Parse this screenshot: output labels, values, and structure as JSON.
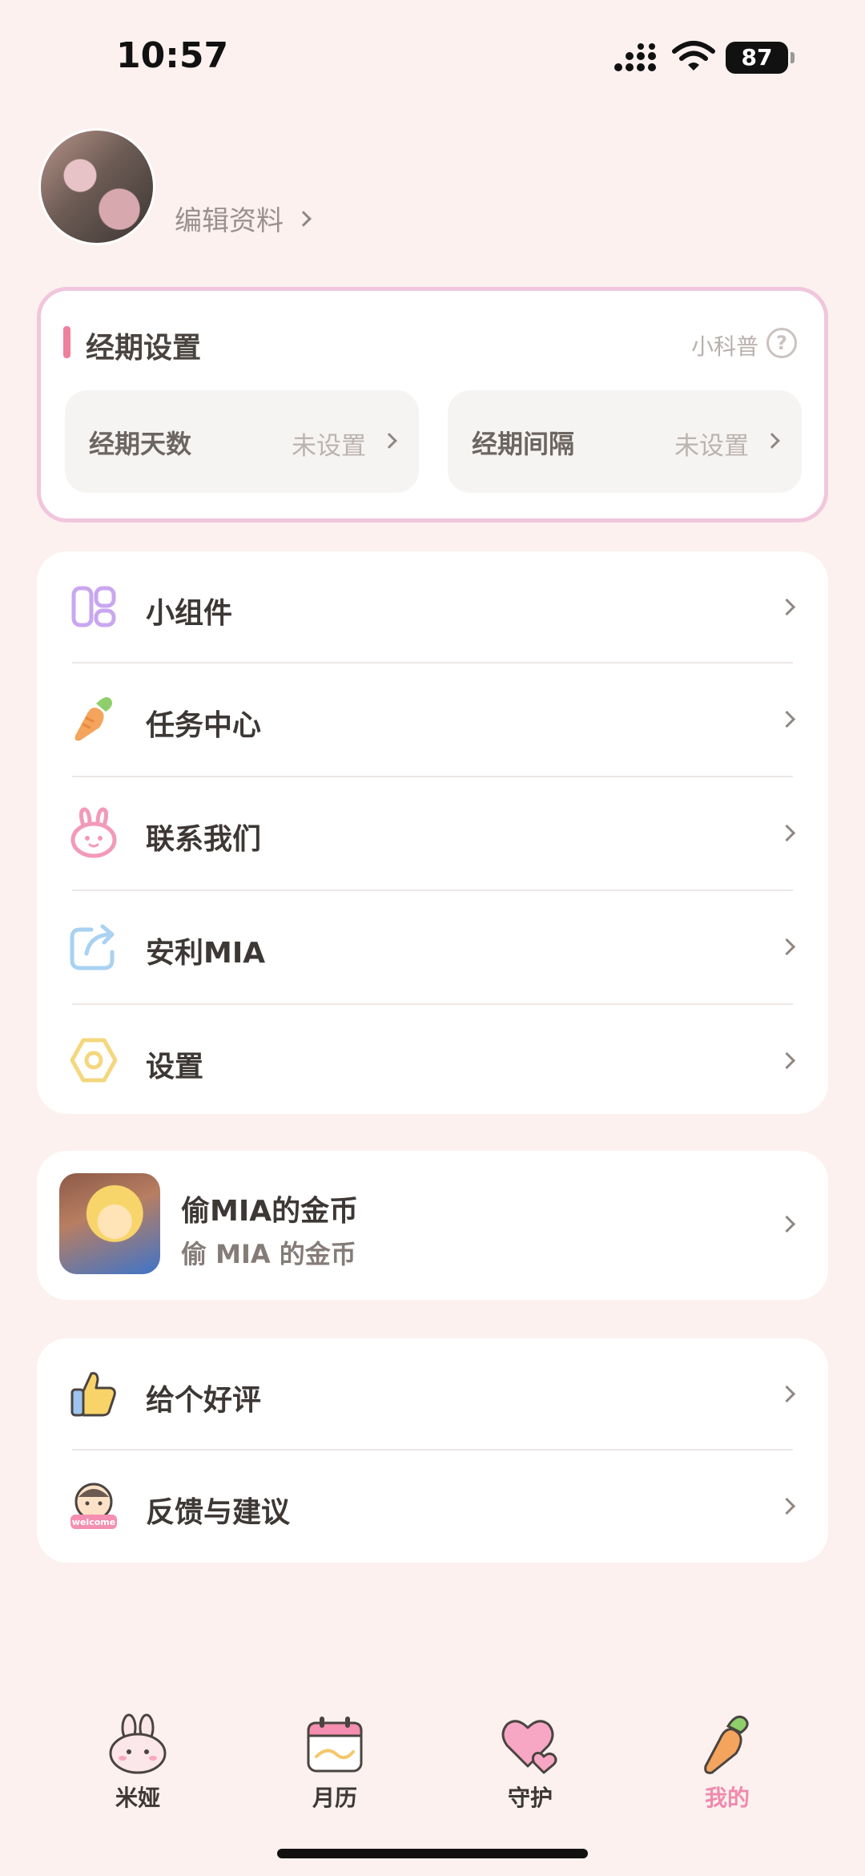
{
  "status_bar": {
    "time": "10:57",
    "battery": "87"
  },
  "profile": {
    "edit_label": "编辑资料"
  },
  "period": {
    "title": "经期设置",
    "science_link": "小科普",
    "days": {
      "label": "经期天数",
      "value": "未设置"
    },
    "interval": {
      "label": "经期间隔",
      "value": "未设置"
    }
  },
  "menu": {
    "items": [
      {
        "label": "小组件",
        "icon": "widget-icon"
      },
      {
        "label": "任务中心",
        "icon": "carrot-icon"
      },
      {
        "label": "联系我们",
        "icon": "bunny-icon"
      },
      {
        "label": "安利MIA",
        "icon": "share-icon"
      },
      {
        "label": "设置",
        "icon": "settings-icon"
      }
    ]
  },
  "promo": {
    "title": "偷MIA的金币",
    "subtitle": "偷 MIA 的金币"
  },
  "feedback": {
    "items": [
      {
        "label": "给个好评",
        "icon": "thumbs-up-icon"
      },
      {
        "label": "反馈与建议",
        "icon": "welcome-face-icon",
        "badge": "welcome"
      }
    ]
  },
  "tabs": [
    {
      "label": "米娅",
      "active": false
    },
    {
      "label": "月历",
      "active": false
    },
    {
      "label": "守护",
      "active": false
    },
    {
      "label": "我的",
      "active": true
    }
  ],
  "colors": {
    "accent_pink": "#f08aae",
    "card_border": "#f1c6dc",
    "background": "#fcf1ef"
  }
}
